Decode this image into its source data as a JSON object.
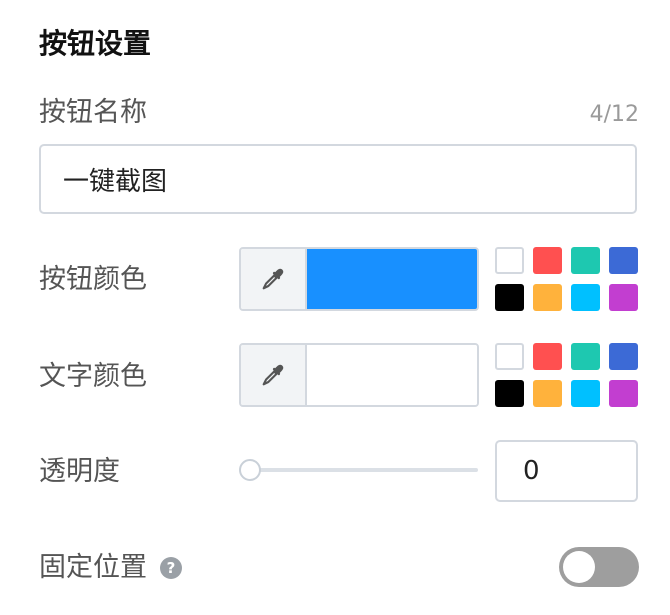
{
  "section": {
    "title": "按钮设置"
  },
  "button_name": {
    "label": "按钮名称",
    "value": "一键截图",
    "counter": "4/12"
  },
  "button_color": {
    "label": "按钮颜色",
    "current": "#1890ff",
    "eyedropper_icon": "eyedropper-icon"
  },
  "text_color": {
    "label": "文字颜色",
    "current": "#ffffff",
    "eyedropper_icon": "eyedropper-icon"
  },
  "palette": {
    "colors": [
      "#ffffff",
      "#ff5050",
      "#1ec8b0",
      "#3c6ad6",
      "#000000",
      "#ffb23c",
      "#00c0ff",
      "#c23ed0"
    ]
  },
  "opacity": {
    "label": "透明度",
    "value": "0",
    "slider_value": 0
  },
  "fixed_position": {
    "label": "固定位置",
    "help_icon": "question-circle-icon",
    "help_glyph": "?",
    "enabled": false
  }
}
